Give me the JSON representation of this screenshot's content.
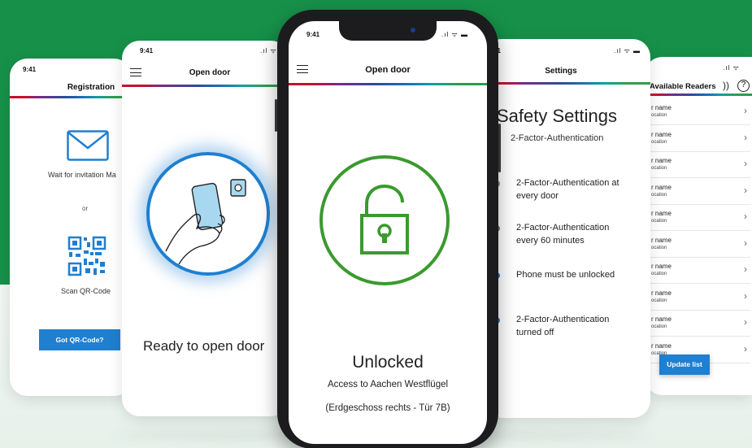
{
  "status_time": "9:41",
  "registration": {
    "title": "Registration",
    "wait_text": "Wait for invitation Ma",
    "or_text": "or",
    "scan_text": "Scan QR-Code",
    "button_label": "Got QR-Code?"
  },
  "open_door_back": {
    "title": "Open door",
    "ready_text": "Ready to open door"
  },
  "main_phone": {
    "title": "Open door",
    "state_text": "Unlocked",
    "access_text": "Access to Aachen Westflügel",
    "detail_text": "(Erdgeschoss rechts - Tür 7B)"
  },
  "settings": {
    "title": "Settings",
    "heading": "Safety Settings",
    "subheading": "2-Factor-Authentication",
    "options": [
      {
        "label": "2-Factor-Authentication at every door",
        "line1": "2-Factor-Authentication at",
        "line2": "every door"
      },
      {
        "label": "2-Factor-Authentication every 60 minutes",
        "line1": "2-Factor-Authentication",
        "line2": "every 60 minutes"
      },
      {
        "label": "Phone must be unlocked",
        "line1": "Phone must be unlocked",
        "line2": ""
      },
      {
        "label": "2-Factor-Authentication turned off",
        "line1": "2-Factor-Authentication",
        "line2": "turned off"
      }
    ]
  },
  "readers": {
    "title": "Available Readers",
    "row_name": "r name",
    "row_location": "ocation",
    "button_label": "Update list"
  },
  "colors": {
    "brand_green": "#17914a",
    "unlock_green": "#3a9a2e",
    "ring_blue": "#1f7fd0",
    "button_blue": "#1f7fd0"
  }
}
